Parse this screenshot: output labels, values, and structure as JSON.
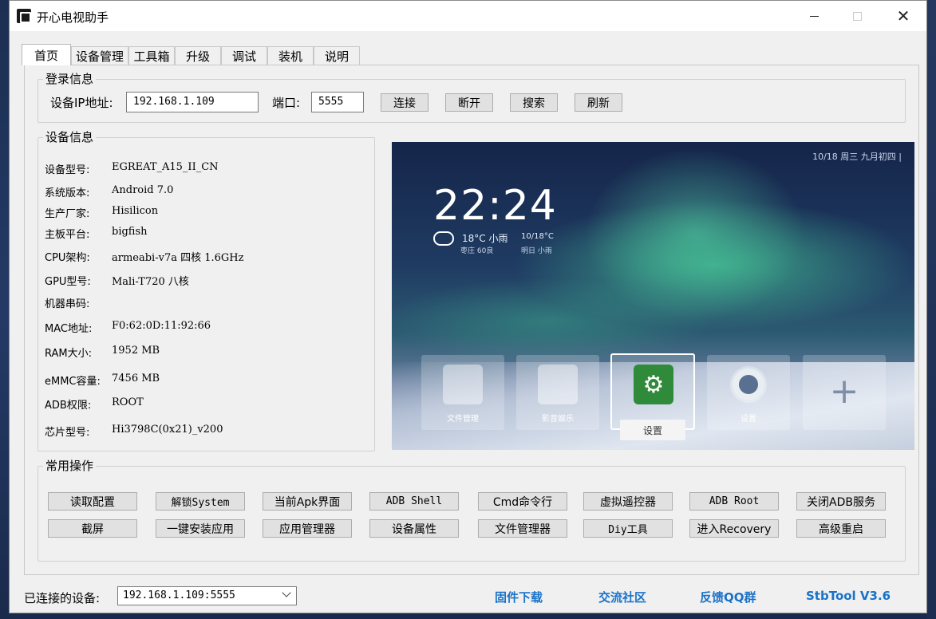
{
  "window": {
    "title": "开心电视助手"
  },
  "tabs": [
    "首页",
    "设备管理",
    "工具箱",
    "升级",
    "调试",
    "装机",
    "说明"
  ],
  "login": {
    "legend": "登录信息",
    "ip_label": "设备IP地址:",
    "ip_value": "192.168.1.109",
    "port_label": "端口:",
    "port_value": "5555",
    "connect": "连接",
    "disconnect": "断开",
    "search": "搜索",
    "refresh": "刷新"
  },
  "device": {
    "legend": "设备信息",
    "rows": [
      {
        "label": "设备型号:",
        "value": "EGREAT_A15_II_CN"
      },
      {
        "label": "系统版本:",
        "value": "Android 7.0"
      },
      {
        "label": "生产厂家:",
        "value": "Hisilicon"
      },
      {
        "label": "主板平台:",
        "value": "bigfish"
      },
      {
        "label": "CPU架构:",
        "value": "armeabi-v7a 四核 1.6GHz"
      },
      {
        "label": "GPU型号:",
        "value": "Mali-T720 八核"
      },
      {
        "label": "机器串码:",
        "value": ""
      },
      {
        "label": "MAC地址:",
        "value": "F0:62:0D:11:92:66"
      },
      {
        "label": "RAM大小:",
        "value": "1952 MB"
      },
      {
        "label": "eMMC容量:",
        "value": "7456 MB"
      },
      {
        "label": "ADB权限:",
        "value": "ROOT"
      },
      {
        "label": "芯片型号:",
        "value": "Hi3798C(0x21)_v200"
      }
    ]
  },
  "screen": {
    "status": "10/18  周三  九月初四  |",
    "clock": "22:24",
    "weather": "18°C 小雨",
    "weather_sub": "枣庄   60良",
    "weather2": "10/18°C",
    "weather2_sub": "明日   小雨",
    "tiles": [
      "文件管理",
      "影音娱乐",
      "",
      "设置",
      ""
    ],
    "popup": "设置"
  },
  "ops": {
    "legend": "常用操作",
    "row1": [
      "读取配置",
      "解锁System",
      "当前Apk界面",
      "ADB Shell",
      "Cmd命令行",
      "虚拟遥控器",
      "ADB  Root",
      "关闭ADB服务"
    ],
    "row2": [
      "截屏",
      "一键安装应用",
      "应用管理器",
      "设备属性",
      "文件管理器",
      "Diy工具",
      "进入Recovery",
      "高级重启"
    ]
  },
  "status_bar": {
    "label": "已连接的设备:",
    "device": "192.168.1.109:5555",
    "links": [
      "固件下载",
      "交流社区",
      "反馈QQ群",
      "StbTool V3.6"
    ]
  }
}
